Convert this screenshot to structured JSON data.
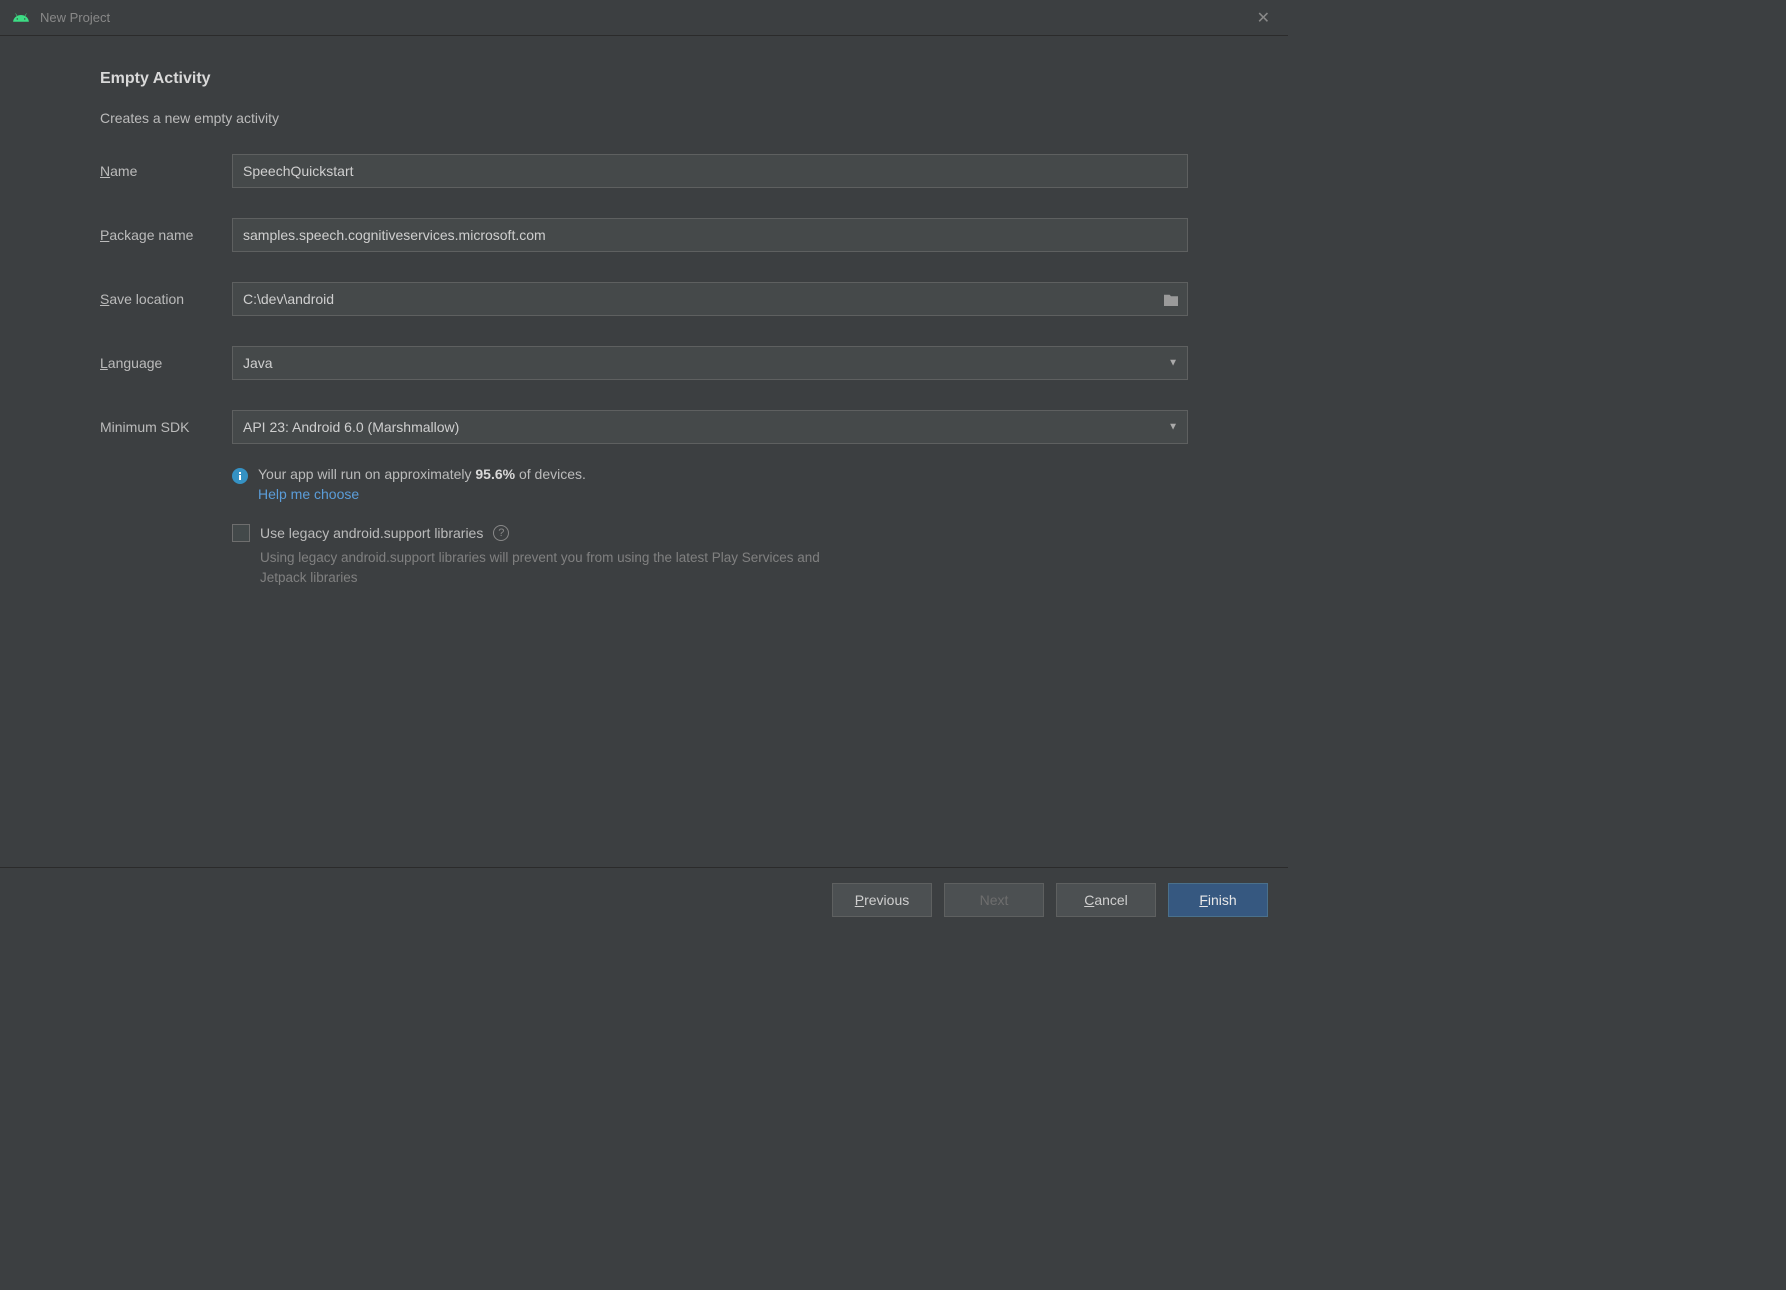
{
  "titlebar": {
    "title": "New Project"
  },
  "page": {
    "heading": "Empty Activity",
    "subheading": "Creates a new empty activity"
  },
  "form": {
    "name": {
      "label_pre": "N",
      "label_rest": "ame",
      "value": "SpeechQuickstart"
    },
    "package": {
      "label_pre": "P",
      "label_rest": "ackage name",
      "value": "samples.speech.cognitiveservices.microsoft.com"
    },
    "savelocation": {
      "label_pre": "S",
      "label_rest": "ave location",
      "value": "C:\\dev\\android"
    },
    "language": {
      "label_pre": "L",
      "label_rest": "anguage",
      "value": "Java"
    },
    "minsdk": {
      "label": "Minimum SDK",
      "value": "API 23: Android 6.0 (Marshmallow)"
    }
  },
  "info": {
    "text_pre": "Your app will run on approximately ",
    "percent": "95.6%",
    "text_post": " of devices.",
    "help_link": "Help me choose"
  },
  "legacy": {
    "label": "Use legacy android.support libraries",
    "hint": "Using legacy android.support libraries will prevent you from using the latest Play Services and Jetpack libraries"
  },
  "footer": {
    "previous_pre": "P",
    "previous_rest": "revious",
    "next": "Next",
    "cancel_pre": "C",
    "cancel_rest": "ancel",
    "finish_pre": "F",
    "finish_rest": "inish"
  }
}
